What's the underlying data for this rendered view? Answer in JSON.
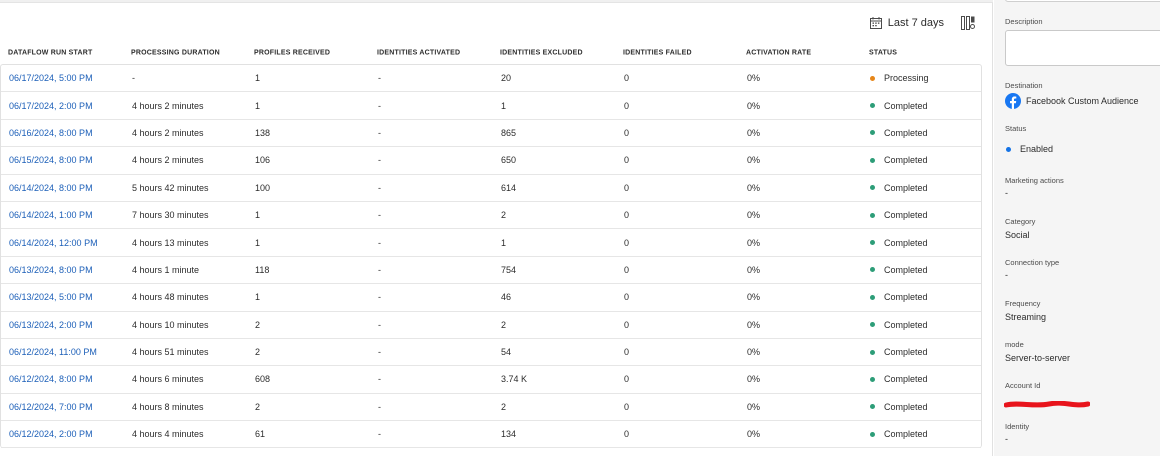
{
  "toolbar": {
    "date_filter_label": "Last 7 days",
    "calendar_icon": "calendar-icon",
    "column_settings_icon": "column-settings-icon"
  },
  "table": {
    "headers": [
      "DATAFLOW RUN START",
      "PROCESSING DURATION",
      "PROFILES RECEIVED",
      "IDENTITIES ACTIVATED",
      "IDENTITIES EXCLUDED",
      "IDENTITIES FAILED",
      "ACTIVATION RATE",
      "STATUS"
    ],
    "rows": [
      {
        "start": "06/17/2024, 5:00 PM",
        "duration": "-",
        "received": "1",
        "activated": "-",
        "excluded": "20",
        "failed": "0",
        "rate": "0%",
        "status": "Processing"
      },
      {
        "start": "06/17/2024, 2:00 PM",
        "duration": "4 hours 2 minutes",
        "received": "1",
        "activated": "-",
        "excluded": "1",
        "failed": "0",
        "rate": "0%",
        "status": "Completed"
      },
      {
        "start": "06/16/2024, 8:00 PM",
        "duration": "4 hours 2 minutes",
        "received": "138",
        "activated": "-",
        "excluded": "865",
        "failed": "0",
        "rate": "0%",
        "status": "Completed"
      },
      {
        "start": "06/15/2024, 8:00 PM",
        "duration": "4 hours 2 minutes",
        "received": "106",
        "activated": "-",
        "excluded": "650",
        "failed": "0",
        "rate": "0%",
        "status": "Completed"
      },
      {
        "start": "06/14/2024, 8:00 PM",
        "duration": "5 hours 42 minutes",
        "received": "100",
        "activated": "-",
        "excluded": "614",
        "failed": "0",
        "rate": "0%",
        "status": "Completed"
      },
      {
        "start": "06/14/2024, 1:00 PM",
        "duration": "7 hours 30 minutes",
        "received": "1",
        "activated": "-",
        "excluded": "2",
        "failed": "0",
        "rate": "0%",
        "status": "Completed"
      },
      {
        "start": "06/14/2024, 12:00 PM",
        "duration": "4 hours 13 minutes",
        "received": "1",
        "activated": "-",
        "excluded": "1",
        "failed": "0",
        "rate": "0%",
        "status": "Completed"
      },
      {
        "start": "06/13/2024, 8:00 PM",
        "duration": "4 hours 1 minute",
        "received": "118",
        "activated": "-",
        "excluded": "754",
        "failed": "0",
        "rate": "0%",
        "status": "Completed"
      },
      {
        "start": "06/13/2024, 5:00 PM",
        "duration": "4 hours 48 minutes",
        "received": "1",
        "activated": "-",
        "excluded": "46",
        "failed": "0",
        "rate": "0%",
        "status": "Completed"
      },
      {
        "start": "06/13/2024, 2:00 PM",
        "duration": "4 hours 10 minutes",
        "received": "2",
        "activated": "-",
        "excluded": "2",
        "failed": "0",
        "rate": "0%",
        "status": "Completed"
      },
      {
        "start": "06/12/2024, 11:00 PM",
        "duration": "4 hours 51 minutes",
        "received": "2",
        "activated": "-",
        "excluded": "54",
        "failed": "0",
        "rate": "0%",
        "status": "Completed"
      },
      {
        "start": "06/12/2024, 8:00 PM",
        "duration": "4 hours 6 minutes",
        "received": "608",
        "activated": "-",
        "excluded": "3.74 K",
        "failed": "0",
        "rate": "0%",
        "status": "Completed"
      },
      {
        "start": "06/12/2024, 7:00 PM",
        "duration": "4 hours 8 minutes",
        "received": "2",
        "activated": "-",
        "excluded": "2",
        "failed": "0",
        "rate": "0%",
        "status": "Completed"
      },
      {
        "start": "06/12/2024, 2:00 PM",
        "duration": "4 hours 4 minutes",
        "received": "61",
        "activated": "-",
        "excluded": "134",
        "failed": "0",
        "rate": "0%",
        "status": "Completed"
      }
    ]
  },
  "status_colors": {
    "Processing": "#e68619",
    "Completed": "#2d9d78"
  },
  "details": {
    "description_label": "Description",
    "description_value": "",
    "destination_label": "Destination",
    "destination_value": "Facebook Custom Audience",
    "destination_icon": "facebook-icon",
    "status_label": "Status",
    "status_value": "Enabled",
    "marketing_label": "Marketing actions",
    "marketing_value": "-",
    "category_label": "Category",
    "category_value": "Social",
    "connection_label": "Connection type",
    "connection_value": "-",
    "frequency_label": "Frequency",
    "frequency_value": "Streaming",
    "mode_label": "mode",
    "mode_value": "Server-to-server",
    "account_label": "Account Id",
    "identity_label": "Identity",
    "identity_value": "-"
  },
  "colors": {
    "link": "#1c5fb8",
    "enabled": "#1473e6",
    "redaction": "#e8141c"
  }
}
